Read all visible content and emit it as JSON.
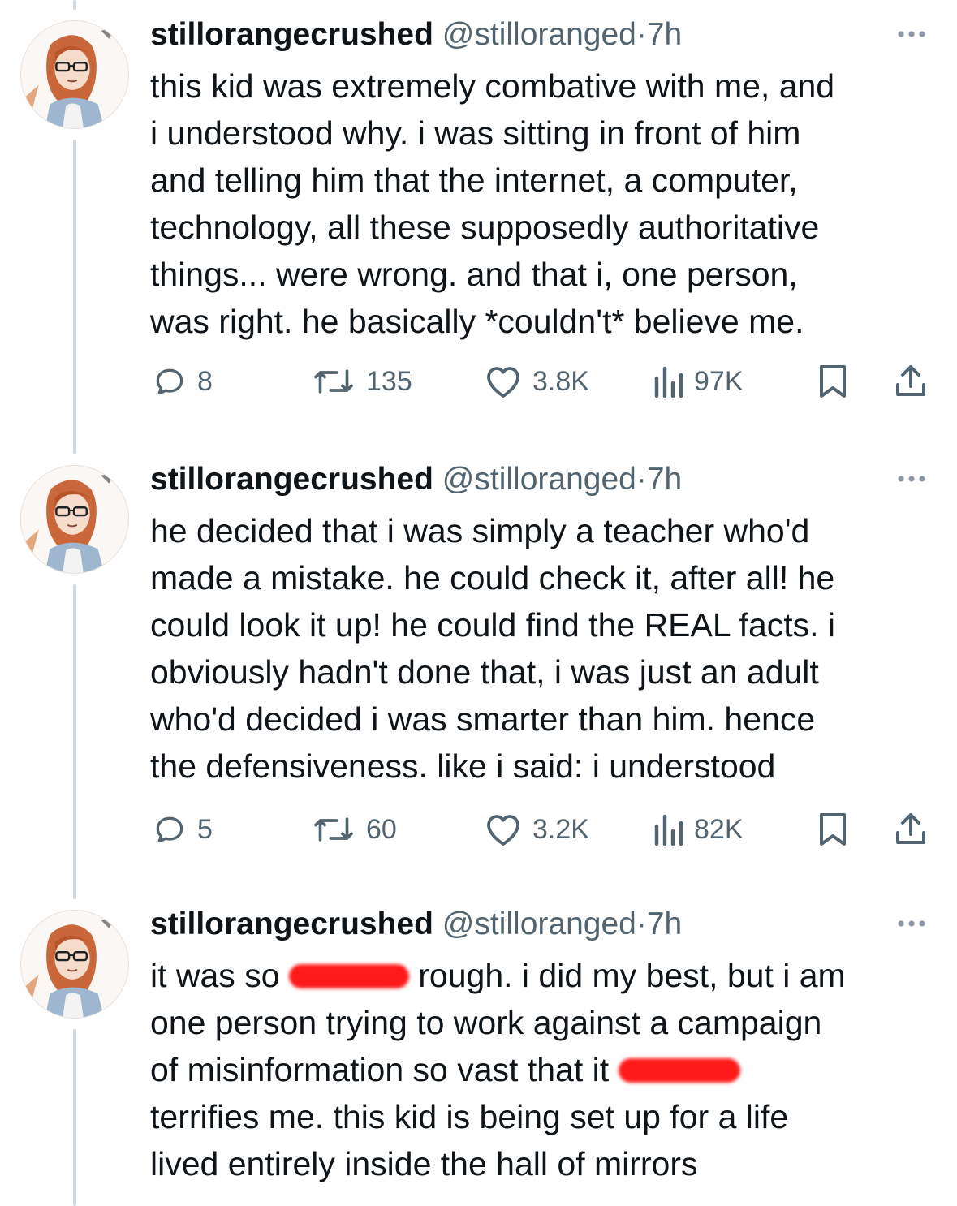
{
  "tweets": [
    {
      "display_name": "stillorangecrushed",
      "handle": "@stilloranged",
      "separator": "·",
      "time": "7h",
      "text": "this kid was extremely combative with me, and\ni understood why. i was sitting in front of him\nand telling him that the internet, a computer,\ntechnology, all these supposedly authoritative\nthings... were wrong. and that i, one person,\nwas right. he basically *couldn't* believe me.",
      "replies": "8",
      "reposts": "135",
      "likes": "3.8K",
      "views": "97K"
    },
    {
      "display_name": "stillorangecrushed",
      "handle": "@stilloranged",
      "separator": "·",
      "time": "7h",
      "text": "he decided that i was simply a teacher who'd\nmade a mistake. he could check it, after all! he\ncould look it up! he could find the REAL facts. i\nobviously hadn't done that, i was just an adult\nwho'd decided i was smarter than him. hence\nthe defensiveness. like i said: i understood",
      "replies": "5",
      "reposts": "60",
      "likes": "3.2K",
      "views": "82K"
    },
    {
      "display_name": "stillorangecrushed",
      "handle": "@stilloranged",
      "separator": "·",
      "time": "7h",
      "text_parts": {
        "line1_a": "it was so ",
        "line1_b": " rough. i did my best, but i am",
        "line2": "one person trying to work against a campaign",
        "line3_a": "of misinformation so vast that it ",
        "line4": "terrifies me. this kid is being set up for a life",
        "line5": "lived entirely inside the hall of mirrors"
      }
    }
  ],
  "icons": [
    "more-icon",
    "reply-icon",
    "repost-icon",
    "like-icon",
    "views-icon",
    "bookmark-icon",
    "share-icon"
  ],
  "colors": {
    "text": "#0f1419",
    "secondary": "#536471",
    "thread_line": "#cfd9de",
    "redaction": "#ff1a1a"
  }
}
